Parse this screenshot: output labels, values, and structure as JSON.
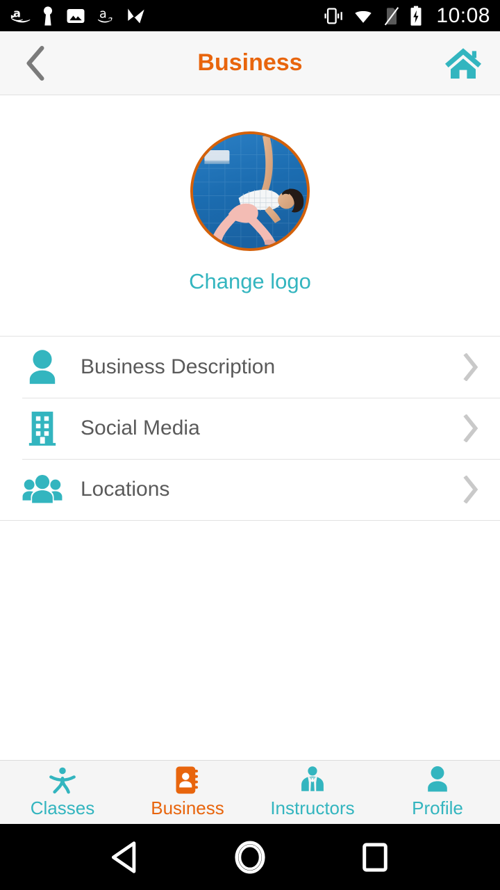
{
  "status_bar": {
    "time": "10:08",
    "left_icons": [
      "amazon-prime-video-icon",
      "keyhole-icon",
      "photo-icon",
      "amazon-icon",
      "checkmark-icon"
    ],
    "right_icons": [
      "vibrate-icon",
      "wifi-icon",
      "no-sim-icon",
      "battery-charging-icon"
    ]
  },
  "header": {
    "title": "Business",
    "back_icon": "chevron-left-icon",
    "home_icon": "home-icon",
    "title_color": "#e8650d",
    "accent_color": "#33b5bf"
  },
  "logo": {
    "change_label": "Change logo",
    "border_color": "#d4610a",
    "alt": "yoga-pose-photo"
  },
  "list": {
    "items": [
      {
        "label": "Business Description",
        "icon": "person-icon",
        "chevron": "chevron-right-icon"
      },
      {
        "label": "Social Media",
        "icon": "building-icon",
        "chevron": "chevron-right-icon"
      },
      {
        "label": "Locations",
        "icon": "group-people-icon",
        "chevron": "chevron-right-icon"
      }
    ]
  },
  "tabbar": {
    "tabs": [
      {
        "label": "Classes",
        "icon": "stick-figure-icon",
        "active": false
      },
      {
        "label": "Business",
        "icon": "address-book-icon",
        "active": true
      },
      {
        "label": "Instructors",
        "icon": "person-tie-icon",
        "active": false
      },
      {
        "label": "Profile",
        "icon": "person-icon",
        "active": false
      }
    ],
    "inactive_color": "#33b5bf",
    "active_color": "#e8650d"
  },
  "navbar": {
    "buttons": [
      {
        "name": "android-back-button",
        "icon": "triangle-left-icon"
      },
      {
        "name": "android-home-button",
        "icon": "circle-icon"
      },
      {
        "name": "android-recents-button",
        "icon": "square-icon"
      }
    ]
  }
}
